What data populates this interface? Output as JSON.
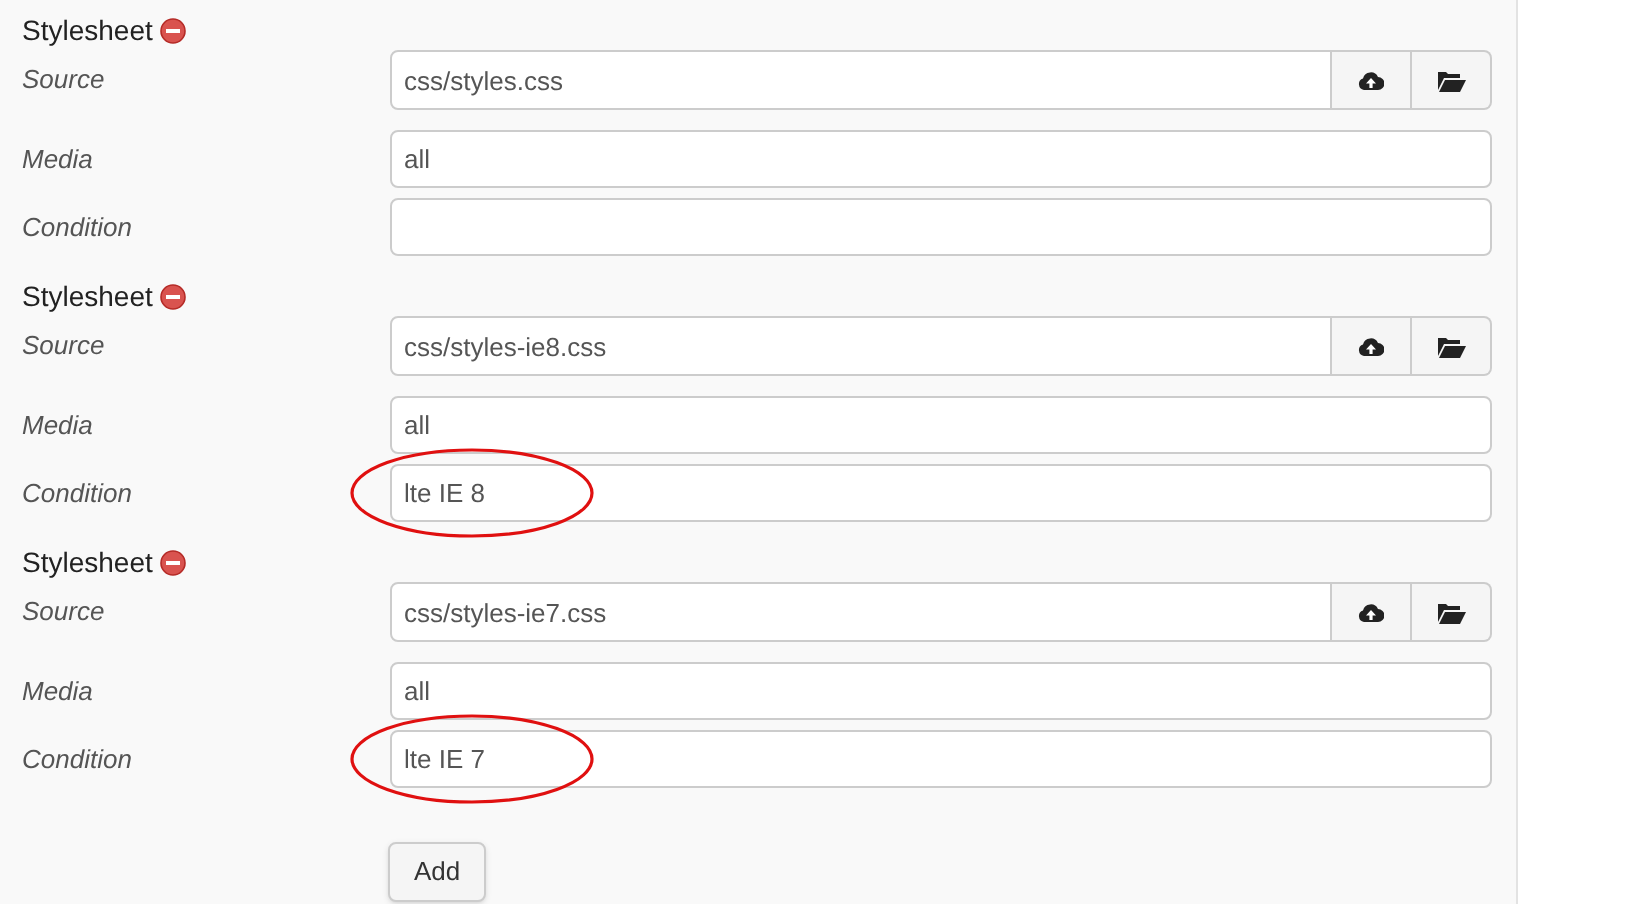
{
  "stylesheets": [
    {
      "heading": "Stylesheet",
      "fields": [
        {
          "kind": "file",
          "label": "Source",
          "value": "css/styles.css"
        },
        {
          "kind": "text",
          "label": "Media",
          "value": "all"
        },
        {
          "kind": "text",
          "label": "Condition",
          "circled": false
        }
      ]
    },
    {
      "heading": "Stylesheet",
      "fields": [
        {
          "kind": "file",
          "label": "Source",
          "value": "css/styles-ie8.css"
        },
        {
          "kind": "text",
          "label": "Media",
          "value": "all"
        },
        {
          "kind": "text",
          "label": "Condition",
          "value": "lte IE 8",
          "circled": true
        }
      ]
    },
    {
      "heading": "Stylesheet",
      "fields": [
        {
          "kind": "file",
          "label": "Source",
          "value": "css/styles-ie7.css"
        },
        {
          "kind": "text",
          "label": "Media",
          "value": "all"
        },
        {
          "kind": "text",
          "label": "Condition",
          "value": "lte IE 7",
          "circled": true
        }
      ]
    }
  ],
  "add_button": "Add"
}
